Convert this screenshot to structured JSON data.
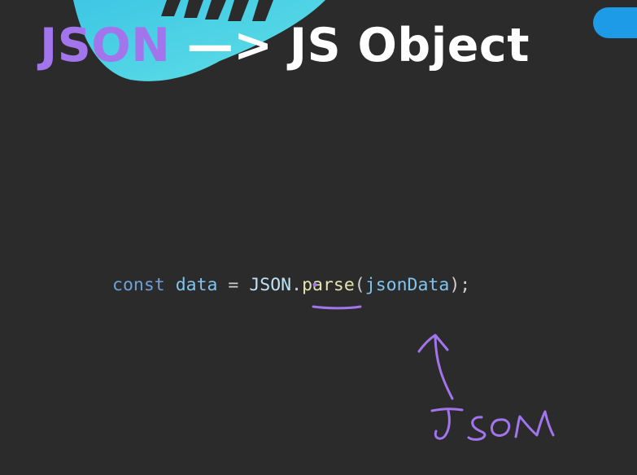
{
  "title": {
    "part1": "JSON",
    "part2": " —> JS Object"
  },
  "code": {
    "keyword": "const",
    "variable": "data",
    "operator": "=",
    "object": "JSON",
    "dot": ".",
    "method": "parse",
    "open_paren": "(",
    "argument": "jsonData",
    "close": ");"
  },
  "annotation": {
    "handwritten_label": "JSON"
  },
  "colors": {
    "background": "#2b2b2c",
    "accent_purple": "#a275ec",
    "accent_cyan": "#4fd7e8",
    "accent_blue": "#1e9be6"
  }
}
